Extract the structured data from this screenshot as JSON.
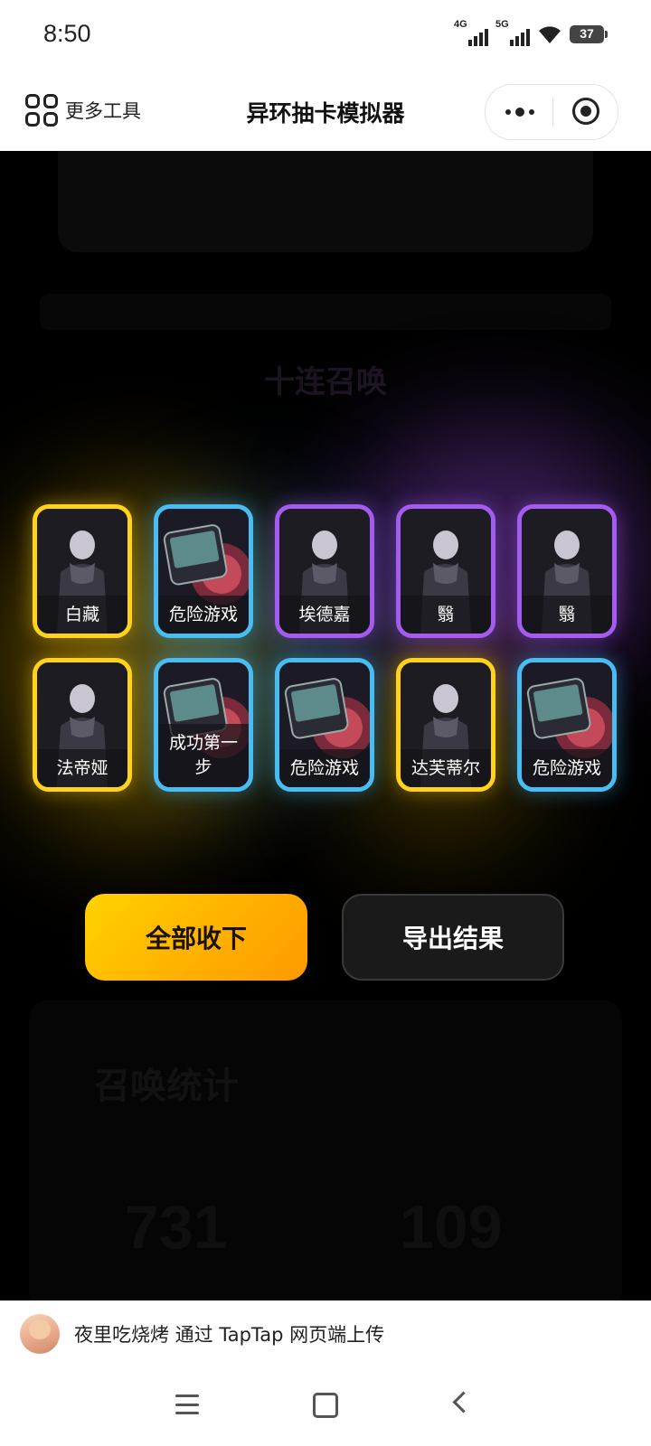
{
  "status_bar": {
    "time": "8:50",
    "network_1": "4G",
    "network_2": "5G",
    "battery": "37",
    "icons": [
      "signal-4g-icon",
      "signal-5g-icon",
      "wifi-icon",
      "battery-icon"
    ]
  },
  "navbar": {
    "more_tools_label": "更多工具",
    "title": "异环抽卡模拟器",
    "icons": [
      "grid-icon",
      "more-dots-icon",
      "target-circle-icon"
    ]
  },
  "results": {
    "cards": [
      {
        "name": "白藏",
        "rarity": "gold",
        "art": "character"
      },
      {
        "name": "危险游戏",
        "rarity": "blue",
        "art": "item"
      },
      {
        "name": "埃德嘉",
        "rarity": "purple",
        "art": "character"
      },
      {
        "name": "翳",
        "rarity": "purple",
        "art": "character"
      },
      {
        "name": "翳",
        "rarity": "purple",
        "art": "character"
      },
      {
        "name": "法帝娅",
        "rarity": "gold",
        "art": "character"
      },
      {
        "name": "成功第一步",
        "rarity": "blue",
        "art": "item"
      },
      {
        "name": "危险游戏",
        "rarity": "blue",
        "art": "item"
      },
      {
        "name": "达芙蒂尔",
        "rarity": "gold",
        "art": "character"
      },
      {
        "name": "危险游戏",
        "rarity": "blue",
        "art": "item"
      }
    ],
    "rarity_colors": {
      "gold": "#ffd21c",
      "blue": "#49bdf2",
      "purple": "#a45cf0"
    }
  },
  "buttons": {
    "accept_all": "全部收下",
    "export": "导出结果"
  },
  "background": {
    "heading": "十连召唤",
    "stats_title": "召唤统计",
    "stat_1": "731",
    "stat_2": "109"
  },
  "attribution": {
    "text": "夜里吃烧烤 通过 TapTap 网页端上传"
  },
  "system_nav": {
    "icons": [
      "menu-icon",
      "home-icon",
      "back-icon"
    ]
  }
}
